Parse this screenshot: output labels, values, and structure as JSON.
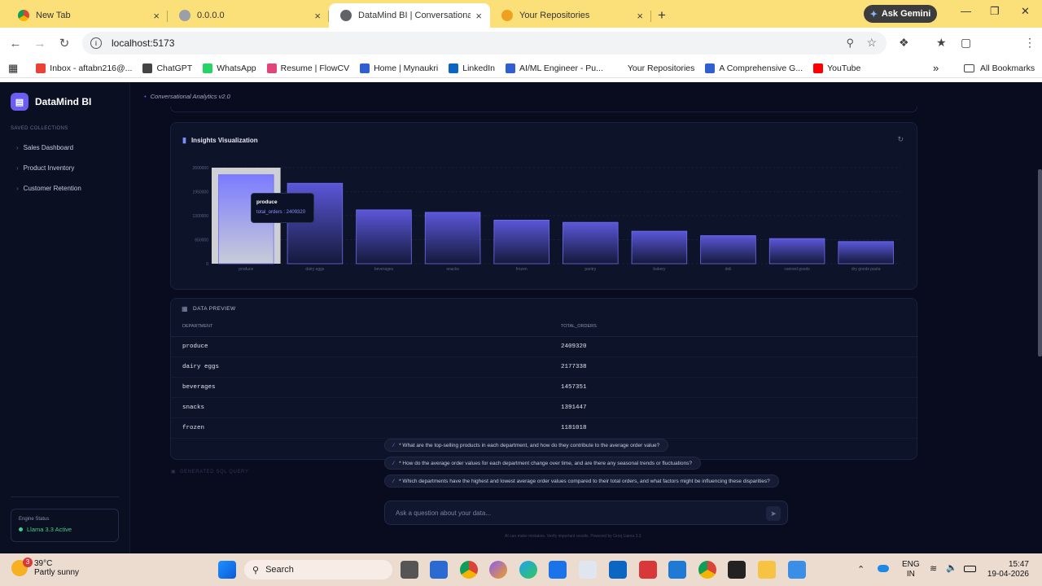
{
  "browser": {
    "tabs": [
      {
        "title": "New Tab",
        "close": "×",
        "color": "#5f6368"
      },
      {
        "title": "0.0.0.0",
        "close": "×",
        "color": "#9aa0a6"
      },
      {
        "title": "DataMind BI | Conversational In",
        "close": "×",
        "color": "#5f6368"
      },
      {
        "title": "Your Repositories",
        "close": "×",
        "color": "#f0a020"
      }
    ],
    "new_tab": "+",
    "ask_gemini": "Ask Gemini",
    "url": "localhost:5173",
    "bookmarks": [
      {
        "label": "Inbox - aftabn216@...",
        "color": "#ea4335"
      },
      {
        "label": "ChatGPT",
        "color": "#444444"
      },
      {
        "label": "WhatsApp",
        "color": "#25d366"
      },
      {
        "label": "Resume | FlowCV",
        "color": "#e0457b"
      },
      {
        "label": "Home | Mynaukri",
        "color": "#2f5fd0"
      },
      {
        "label": "LinkedIn",
        "color": "#0a66c2"
      },
      {
        "label": "AI/ML Engineer - Pu...",
        "color": "#2f5fd0"
      },
      {
        "label": "Your Repositories",
        "color": "#ffffff"
      },
      {
        "label": "A Comprehensive G...",
        "color": "#2f5fd0"
      },
      {
        "label": "YouTube",
        "color": "#ff0000"
      }
    ],
    "more_bookmarks": "»",
    "all_bookmarks": "All Bookmarks"
  },
  "app": {
    "name": "DataMind BI",
    "version_label": "Conversational Analytics v2.0",
    "sidebar": {
      "section_title": "SAVED COLLECTIONS",
      "items": [
        "Sales Dashboard",
        "Product Inventory",
        "Customer Retention"
      ],
      "engine_title": "Engine Status",
      "engine_status": "Llama 3.3 Active"
    },
    "chart_card": {
      "title": "Insights Visualization"
    },
    "tooltip": {
      "title": "produce",
      "line": "total_orders : 2409320"
    },
    "preview": {
      "title": "DATA PREVIEW",
      "columns": [
        "DEPARTMENT",
        "TOTAL_ORDERS"
      ],
      "rows": [
        [
          "produce",
          "2409320"
        ],
        [
          "dairy eggs",
          "2177338"
        ],
        [
          "beverages",
          "1457351"
        ],
        [
          "snacks",
          "1391447"
        ],
        [
          "frozen",
          "1181018"
        ]
      ]
    },
    "sql_toggle": "GENERATED SQL QUERY",
    "suggestions": [
      "* What are the top-selling products in each department, and how do they contribute to the average order value?",
      "* How do the average order values for each department change over time, and are there any seasonal trends or fluctuations?",
      "* Which departments have the highest and lowest average order values compared to their total orders, and what factors might be influencing these disparities?"
    ],
    "ask_placeholder": "Ask a question about your data...",
    "footer": "AI can make mistakes. Verify important results. Powered by Groq Llama 3.3"
  },
  "chart_data": {
    "type": "bar",
    "categories": [
      "produce",
      "dairy eggs",
      "beverages",
      "snacks",
      "frozen",
      "pantry",
      "bakery",
      "deli",
      "canned goods",
      "dry goods pasta"
    ],
    "series": [
      {
        "name": "total_orders",
        "values": [
          2409320,
          2177338,
          1457351,
          1391447,
          1181018,
          1120000,
          880000,
          760000,
          680000,
          600000
        ]
      }
    ],
    "yticks": [
      0,
      650000,
      1300000,
      1950000,
      2600000
    ],
    "ylim": [
      0,
      2600000
    ],
    "highlighted": "produce",
    "bar_color": "#5b57d9",
    "grid": true
  },
  "taskbar": {
    "weather_temp": "39°C",
    "weather_desc": "Partly sunny",
    "weather_badge": "3",
    "search": "Search",
    "lang_top": "ENG",
    "lang_bottom": "IN",
    "time": "15:47",
    "date": "19-04-2026"
  }
}
